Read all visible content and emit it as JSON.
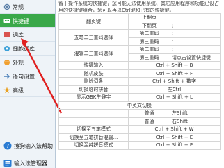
{
  "sidebar": {
    "items": [
      {
        "label": "常规",
        "icon": "gear-icon"
      },
      {
        "label": "快捷键",
        "icon": "keyboard-icon"
      },
      {
        "label": "词库",
        "icon": "book-icon"
      },
      {
        "label": "细胞词库",
        "icon": "cell-icon"
      },
      {
        "label": "外观",
        "icon": "palette-icon"
      },
      {
        "label": "语句设置",
        "icon": "arrow-icon"
      },
      {
        "label": "高级",
        "icon": "star-icon"
      }
    ],
    "active_index": 1,
    "bottom_buttons": [
      {
        "label": "搜狗输入法帮助",
        "icon": "help-icon"
      },
      {
        "label": "输入法管理器",
        "icon": "manager-icon"
      }
    ]
  },
  "main": {
    "intro": "留于操作系统的快捷键，您可能无法使用系统、其它应用程序和功能已设占用的快捷键组合，您可以再以Ctrl键和已有的快捷键。",
    "rows": [
      {
        "c1": "翻页键",
        "c2": "上翻页",
        "c3": ""
      },
      {
        "c1": "",
        "c2": "下翻页",
        "c3": ";"
      },
      {
        "c1": "五笔二三重码选择",
        "c2": "第二重码",
        "c3": ";"
      },
      {
        "c1": "",
        "c2": "第三重码",
        "c3": "'"
      },
      {
        "c1": "混输二三重码选择",
        "c2": "第二重码",
        "c3": ";"
      },
      {
        "c1": "",
        "c2": "第三重码",
        "c3": "请点击设置快捷键"
      },
      {
        "c1": "快捷输入",
        "c23": "Ctrl + Shift + B"
      },
      {
        "c1": "随机皮肤",
        "c23": "Ctrl + Shift + F"
      },
      {
        "c1": "删除词条",
        "c23": "Ctrl + Shift + 数字"
      },
      {
        "c1": "切换临时拼音",
        "c23": "左Ctrl"
      },
      {
        "c1": "显示GBK生僻字",
        "c23": "Ctrl + Shift + L"
      },
      {
        "c1": "中英文切换",
        "c2": "普通",
        "c3": "左Shift"
      },
      {
        "c1": "",
        "c2": "普通",
        "c3": "右Shift"
      },
      {
        "c1": "切换至五笔模式",
        "c23": "Ctrl + Shift + W"
      },
      {
        "c1": "切换至五笔拼音混输...",
        "c23": "Ctrl + Shift + E"
      },
      {
        "c1": "切换至纯拼音模式",
        "c23": "Ctrl + Shift + P"
      }
    ]
  },
  "colors": {
    "active_nav": "#3aa84a",
    "arrow": "#e02020"
  }
}
